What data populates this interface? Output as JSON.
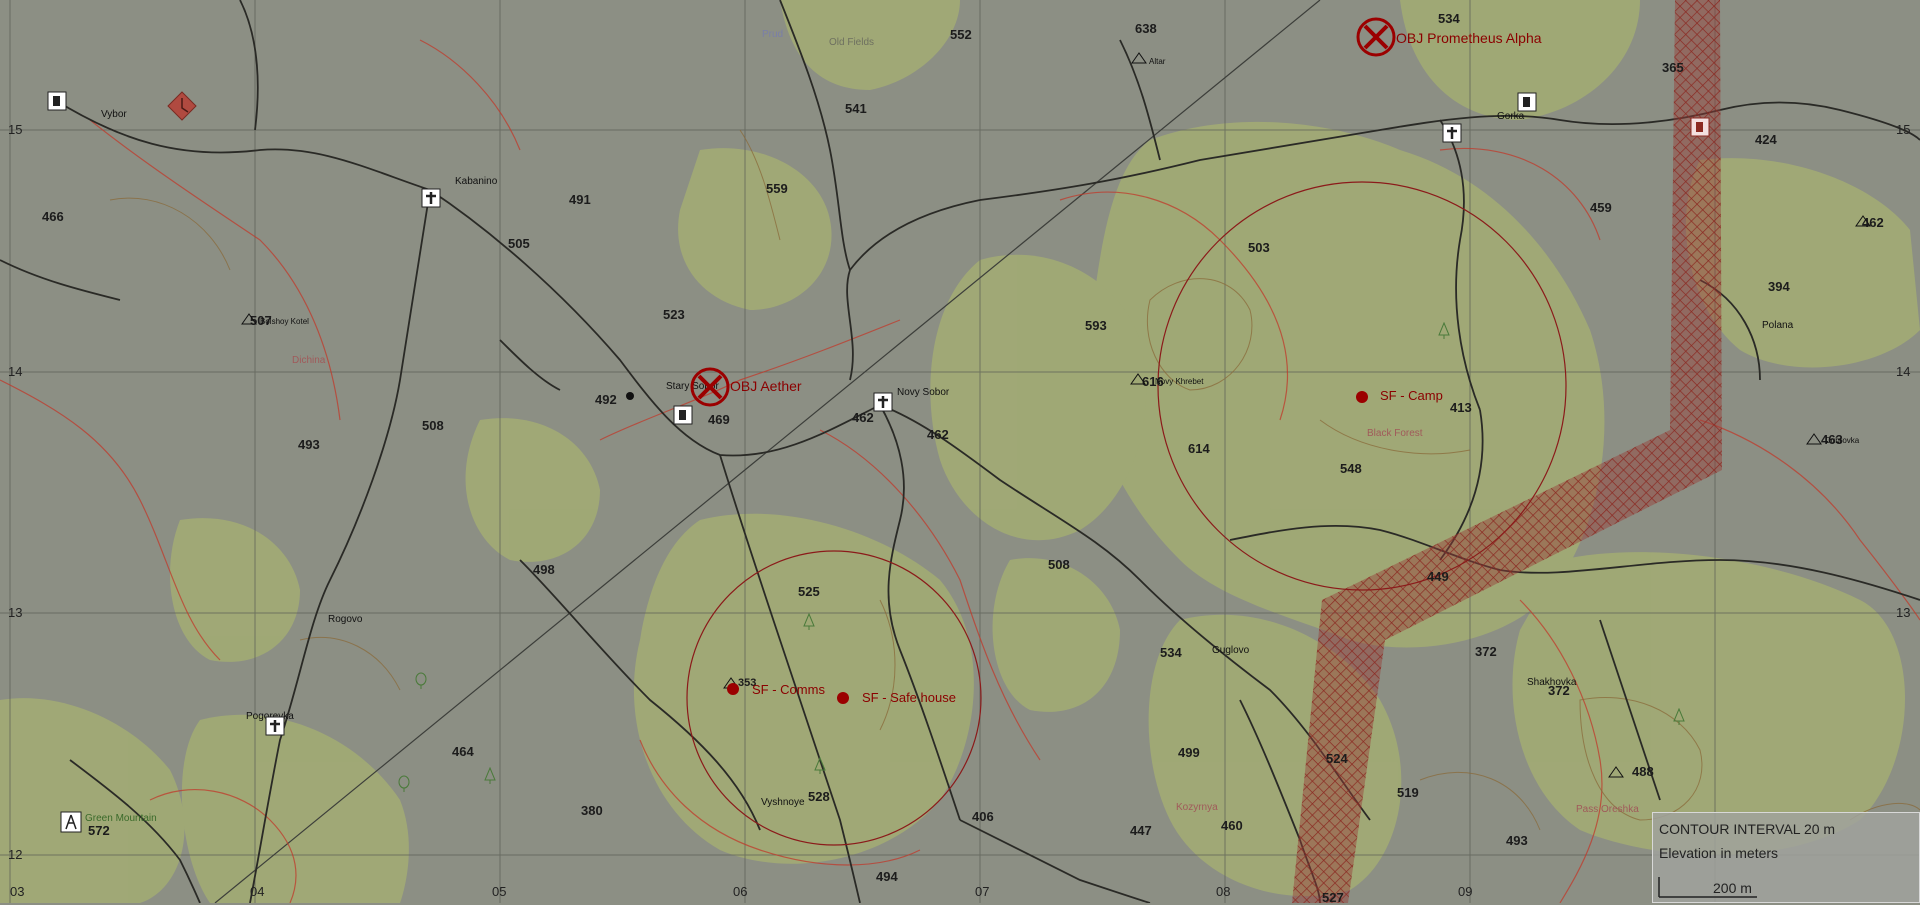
{
  "map": {
    "colors": {
      "background": "#8c8f84",
      "forest": "#a4b273",
      "road": "#2a2a26",
      "contour_red": "#c0392b",
      "contour_brown": "#8a6a3a",
      "marker": "#8b0000"
    },
    "grid_labels": {
      "left": [
        "15",
        "14",
        "13",
        "12"
      ],
      "right": [
        "15",
        "14",
        "13"
      ],
      "bottom": [
        "03",
        "04",
        "05",
        "06",
        "07",
        "08",
        "09"
      ]
    },
    "elevations": [
      "552",
      "638",
      "534",
      "541",
      "559",
      "491",
      "505",
      "466",
      "523",
      "507",
      "492",
      "469",
      "462",
      "462",
      "508",
      "493",
      "498",
      "593",
      "616",
      "614",
      "503",
      "459",
      "424",
      "365",
      "462",
      "394",
      "413",
      "548",
      "463",
      "508",
      "525",
      "449",
      "534",
      "372",
      "372",
      "499",
      "524",
      "519",
      "488",
      "447",
      "460",
      "493",
      "406",
      "528",
      "464",
      "380",
      "572",
      "494",
      "527",
      "353"
    ],
    "towns": [
      "Vybor",
      "Kabanino",
      "Stary Sobor",
      "Novy Sobor",
      "Gorka",
      "Polana",
      "Rogovo",
      "Pogorevka",
      "Vyshnoye",
      "Guglovo",
      "Shakhovka",
      "Green Mountain",
      "Dichina",
      "Black Forest",
      "Kozyrnya",
      "Pass Oreshka",
      "Prud",
      "Old Fields",
      "Altar",
      "Novy Khrebet",
      "Bolshoy Kotel",
      "Dubrovka"
    ],
    "markers": {
      "obj_aether": "OBJ Aether",
      "obj_prometheus": "OBJ Prometheus Alpha",
      "sf_camp": "SF - Camp",
      "sf_comms": "SF - Comms",
      "sf_safehouse": "SF - Safe house"
    },
    "legend": {
      "contour": "CONTOUR INTERVAL 20 m",
      "elevation": "Elevation in meters",
      "scale": "200 m"
    }
  }
}
